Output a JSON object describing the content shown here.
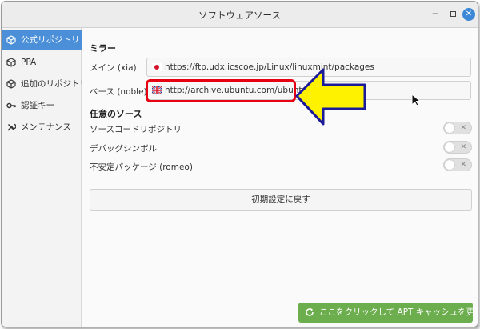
{
  "window": {
    "title": "ソフトウェアソース"
  },
  "sidebar": {
    "items": [
      {
        "label": "公式リポジトリ",
        "icon": "package-icon",
        "active": true
      },
      {
        "label": "PPA",
        "icon": "package-icon"
      },
      {
        "label": "追加のリポジトリ",
        "icon": "package-icon"
      },
      {
        "label": "認証キー",
        "icon": "key-icon"
      },
      {
        "label": "メンテナンス",
        "icon": "tools-icon"
      }
    ]
  },
  "mirrors": {
    "heading": "ミラー",
    "main": {
      "label": "メイン (xia)",
      "value": "https://ftp.udx.icscoe.jp/Linux/linuxmint/packages",
      "flag": "japan-flag-icon"
    },
    "base": {
      "label": "ベース (noble)",
      "value": "http://archive.ubuntu.com/ubuntu",
      "flag": "uk-flag-icon"
    }
  },
  "optional": {
    "heading": "任意のソース",
    "items": [
      {
        "label": "ソースコードリポジトリ",
        "enabled": false
      },
      {
        "label": "デバッグシンボル",
        "enabled": false
      },
      {
        "label": "不安定パッケージ (romeo)",
        "enabled": false
      }
    ]
  },
  "buttons": {
    "reset": "初期設定に戻す",
    "update": "ここをクリックして APT キャッシュを更新します"
  },
  "colors": {
    "accent": "#4a8fd8",
    "update_button": "#6cad4e",
    "highlight": "#e60012",
    "arrow": "#fff200"
  }
}
